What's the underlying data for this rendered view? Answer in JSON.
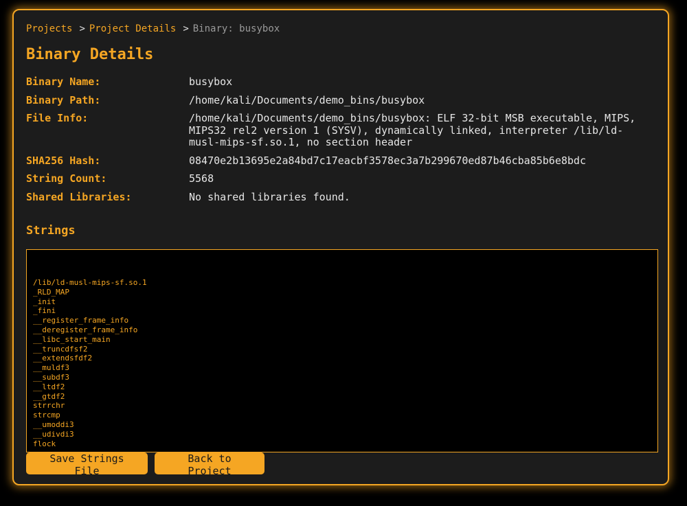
{
  "breadcrumb": {
    "items": [
      "Projects",
      "Project Details"
    ],
    "separator": ">",
    "current": "Binary: busybox"
  },
  "page": {
    "title": "Binary Details"
  },
  "details": [
    {
      "label": "Binary Name:",
      "value": "busybox"
    },
    {
      "label": "Binary Path:",
      "value": "/home/kali/Documents/demo_bins/busybox"
    },
    {
      "label": "File Info:",
      "value": "/home/kali/Documents/demo_bins/busybox: ELF 32-bit MSB executable, MIPS, MIPS32 rel2 version 1 (SYSV), dynamically linked, interpreter /lib/ld-musl-mips-sf.so.1, no section header"
    },
    {
      "label": "SHA256 Hash:",
      "value": "08470e2b13695e2a84bd7c17eacbf3578ec3a7b299670ed87b46cba85b6e8bdc"
    },
    {
      "label": "String Count:",
      "value": "5568"
    },
    {
      "label": "Shared Libraries:",
      "value": "No shared libraries found."
    }
  ],
  "strings": {
    "title": "Strings",
    "lines": [
      "/lib/ld-musl-mips-sf.so.1",
      "_RLD_MAP",
      "_init",
      "_fini",
      "__register_frame_info",
      "__deregister_frame_info",
      "__libc_start_main",
      "__truncdfsf2",
      "__extendsfdf2",
      "__muldf3",
      "__subdf3",
      "__ltdf2",
      "__gtdf2",
      "strrchr",
      "strcmp",
      "__umoddi3",
      "__udivdi3",
      "flock"
    ]
  },
  "buttons": {
    "save": "Save Strings File",
    "back": "Back to Project"
  },
  "colors": {
    "accent": "#f5a623",
    "panel_bg": "#1c1c1c",
    "text": "#e6e6e6",
    "muted": "#9a9a9a"
  }
}
